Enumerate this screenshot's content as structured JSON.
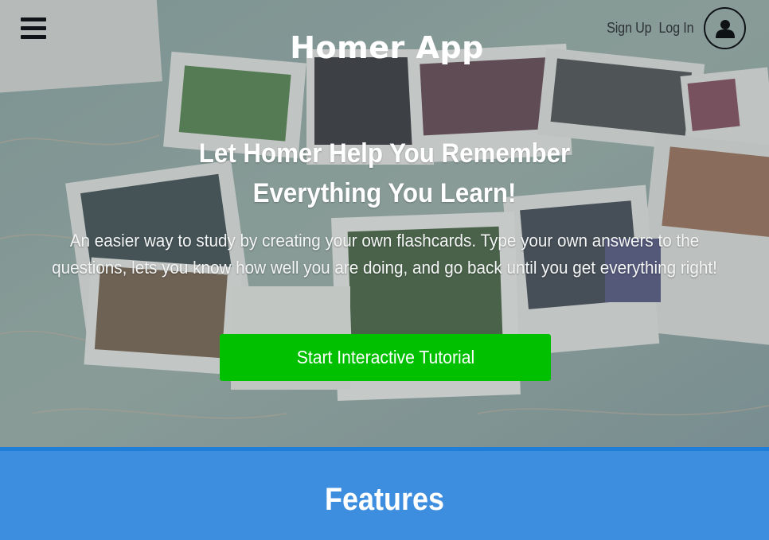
{
  "nav": {
    "menu_icon": "hamburger-menu-icon",
    "brand": "Homer App",
    "signup_label": "Sign Up",
    "login_label": "Log In",
    "avatar_icon": "user-icon"
  },
  "hero": {
    "headline_line1": "Let Homer Help You Remember",
    "headline_line2": "Everything You Learn!",
    "sub_line1": "An easier way to study by creating your own flashcards. Type your own answers to the",
    "sub_line2": "questions, lets you know how well you are doing, and go back until you get everything right!",
    "cta_label": "Start Interactive Tutorial"
  },
  "features": {
    "title": "Features"
  },
  "colors": {
    "cta": "#00c000",
    "features_bg": "#3e8ee0",
    "features_border": "#1f7fd8"
  }
}
